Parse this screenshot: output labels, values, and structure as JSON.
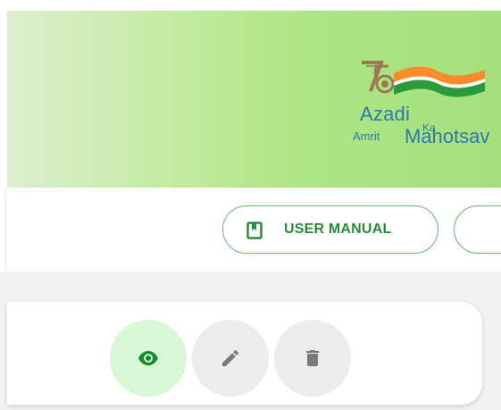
{
  "banner": {
    "logo_number": "75",
    "logo_line1": "Azadi",
    "logo_ka": "Ka",
    "logo_amrit": "Amrit",
    "logo_mahotsav": "Mahotsav",
    "logo_icon": "azadi-ka-amrit-mahotsav-logo"
  },
  "toolbar": {
    "user_manual_label": "USER MANUAL",
    "user_manual_icon": "book-icon"
  },
  "row_actions": {
    "view_icon": "eye-icon",
    "edit_icon": "pencil-icon",
    "delete_icon": "trash-icon"
  },
  "colors": {
    "accent_green": "#2a8a3a",
    "button_border": "#63b86a",
    "view_bg": "#d8f7d4",
    "neutral_bg": "#ececec"
  }
}
